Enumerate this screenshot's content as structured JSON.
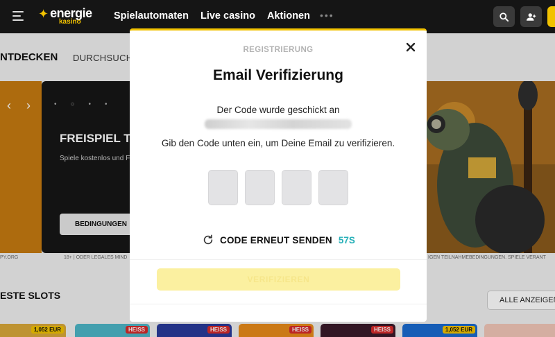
{
  "header": {
    "logo_text": "energie",
    "logo_sub": "kasino",
    "nav": [
      "Spielautomaten",
      "Live casino",
      "Aktionen"
    ],
    "more": "•••"
  },
  "background": {
    "section_heading": "NTDECKEN",
    "section_sub": "DURCHSUCHE",
    "banner": {
      "title": "FREISPIEL T",
      "description": "Spiele kostenlos und Freispieltopfs!",
      "button": "BEDINGUNGEN"
    },
    "fine_left": "PY.ORG",
    "fine_mid": "18+ | ODER LEGALES MIND",
    "fine_right": "IGEN TEILNAHMEBEDINGUNGEN. SPIELE VERANT",
    "slots_heading": "ESTE SLOTS",
    "show_all": "ALLE ANZEIGEN",
    "tiles": [
      {
        "badge": "1,052 EUR"
      },
      {
        "badge": "HEISS"
      },
      {
        "badge": "HEISS"
      },
      {
        "badge": "HEISS"
      },
      {
        "badge": "HEISS"
      },
      {
        "badge": "1,052 EUR"
      }
    ]
  },
  "modal": {
    "kicker": "REGISTRIERUNG",
    "title": "Email Verifizierung",
    "sent_text": "Der Code wurde geschickt an",
    "instruction": "Gib den Code unten ein, um Deine Email zu verifizieren.",
    "resend_label": "CODE ERNEUT SENDEN",
    "countdown": "57S",
    "verify_label": "VERIFIZIEREN"
  }
}
